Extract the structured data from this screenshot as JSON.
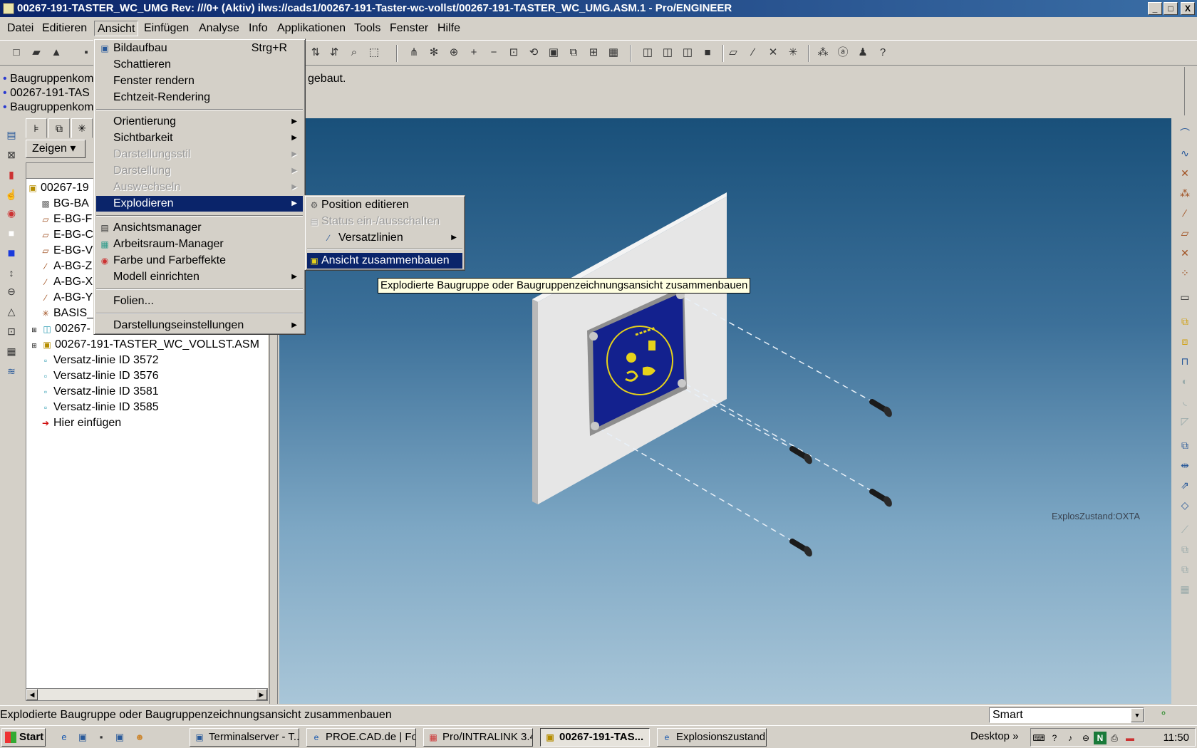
{
  "window": {
    "title": "00267-191-TASTER_WC_UMG Rev: ///0+ (Aktiv) ilws://cads1/00267-191-Taster-wc-vollst/00267-191-TASTER_WC_UMG.ASM.1 - Pro/ENGINEER",
    "min": "_",
    "max": "□",
    "close": "X"
  },
  "menubar": [
    "Datei",
    "Editieren",
    "Ansicht",
    "Einfügen",
    "Analyse",
    "Info",
    "Applikationen",
    "Tools",
    "Fenster",
    "Hilfe"
  ],
  "messages": [
    {
      "text": "Baugruppenkom",
      "suffix": "gebaut."
    },
    {
      "text": "00267-191-TAS"
    },
    {
      "text": "Baugruppenkom"
    }
  ],
  "tree": {
    "zeigen": "Zeigen",
    "items": [
      {
        "label": "00267-19",
        "icon": "asm-icon"
      },
      {
        "label": "BG-BA",
        "icon": "datum-icon"
      },
      {
        "label": "E-BG-F",
        "icon": "plane-icon"
      },
      {
        "label": "E-BG-C",
        "icon": "plane-icon"
      },
      {
        "label": "E-BG-V",
        "icon": "plane-icon"
      },
      {
        "label": "A-BG-Z",
        "icon": "axis-icon"
      },
      {
        "label": "A-BG-X",
        "icon": "axis-icon"
      },
      {
        "label": "A-BG-Y",
        "icon": "axis-icon"
      },
      {
        "label": "BASIS_",
        "icon": "csys-icon"
      },
      {
        "label": "00267-",
        "icon": "part-icon"
      },
      {
        "label": "00267-191-TASTER_WC_VOLLST.ASM",
        "icon": "asm-icon"
      },
      {
        "label": "Versatz-linie ID 3572",
        "icon": "offset-icon"
      },
      {
        "label": "Versatz-linie ID 3576",
        "icon": "offset-icon"
      },
      {
        "label": "Versatz-linie ID 3581",
        "icon": "offset-icon"
      },
      {
        "label": "Versatz-linie ID 3585",
        "icon": "offset-icon"
      },
      {
        "label": "Hier einfügen",
        "icon": "insert-arrow-icon"
      }
    ]
  },
  "ansicht_menu": {
    "items": [
      {
        "label": "Bildaufbau",
        "shortcut": "Strg+R"
      },
      {
        "label": "Schattieren"
      },
      {
        "label": "Fenster rendern"
      },
      {
        "label": "Echtzeit-Rendering"
      },
      {
        "label": "Orientierung"
      },
      {
        "label": "Sichtbarkeit"
      },
      {
        "label": "Darstellungsstil"
      },
      {
        "label": "Darstellung"
      },
      {
        "label": "Auswechseln"
      },
      {
        "label": "Explodieren"
      },
      {
        "label": "Ansichtsmanager"
      },
      {
        "label": "Arbeitsraum-Manager"
      },
      {
        "label": "Farbe und Farbeffekte"
      },
      {
        "label": "Modell einrichten"
      },
      {
        "label": "Folien..."
      },
      {
        "label": "Darstellungseinstellungen"
      }
    ]
  },
  "explode_submenu": {
    "items": [
      {
        "label": "Position editieren"
      },
      {
        "label": "Status ein-/ausschalten"
      },
      {
        "label": "Versatzlinien"
      },
      {
        "label": "Ansicht zusammenbauen"
      }
    ]
  },
  "tooltip": "Explodierte Baugruppe oder Baugruppenzeichnungsansicht zusammenbauen",
  "viewport": {
    "explode_state": "ExplosZustand:OXTA"
  },
  "statusbar": {
    "text": "Explodierte Baugruppe oder Baugruppenzeichnungsansicht zusammenbauen",
    "filter": "Smart"
  },
  "taskbar": {
    "start": "Start",
    "tasks": [
      "Terminalserver - T...",
      "PROE.CAD.de | Fo...",
      "Pro/INTRALINK 3.4",
      "00267-191-TAS...",
      "Explosionszustand!..."
    ],
    "desktop": "Desktop",
    "clock": "11:50"
  }
}
